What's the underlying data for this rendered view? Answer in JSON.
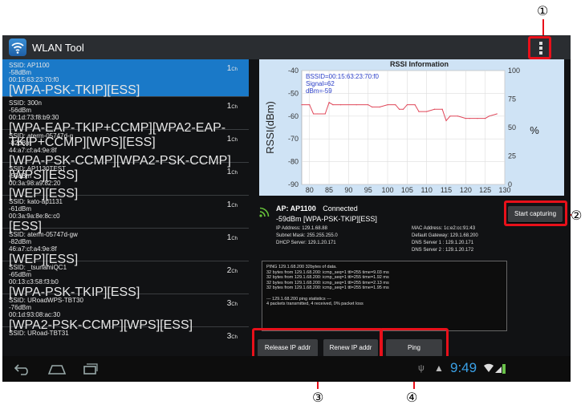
{
  "app": {
    "title": "WLAN Tool"
  },
  "networks": [
    {
      "ssid": "SSID: AP1100",
      "signal": "-58dBm",
      "bssid": "00:15:63:23:70:f0",
      "security": "[WPA-PSK-TKIP][ESS]",
      "channel": "1",
      "ch_unit": "Ch"
    },
    {
      "ssid": "SSID: 300n",
      "signal": "-56dBm",
      "bssid": "00:1d:73:f8:b9:30",
      "security": "[WPA-EAP-TKIP+CCMP][WPA2-EAP-TKIP+CCMP][WPS][ESS]",
      "channel": "1",
      "ch_unit": "Ch"
    },
    {
      "ssid": "SSID: aterm-05747d-g",
      "signal": "-82dBm",
      "bssid": "44:a7:cf:a4:9e:8f",
      "security": "[WPA-PSK-CCMP][WPA2-PSK-CCMP][WPS][ESS]",
      "channel": "1",
      "ch_unit": "Ch"
    },
    {
      "ssid": "SSID: AP1130TEST",
      "signal": "-53dBm",
      "bssid": "00:3a:98:a9:82:20",
      "security": "[WEP][ESS]",
      "channel": "1",
      "ch_unit": "Ch"
    },
    {
      "ssid": "SSID: kato-ap1131",
      "signal": "-61dBm",
      "bssid": "00:3a:9a:8e:8c:c0",
      "security": "[ESS]",
      "channel": "1",
      "ch_unit": "Ch"
    },
    {
      "ssid": "SSID: aterm-05747d-gw",
      "signal": "-82dBm",
      "bssid": "46:a7:cf:a4:9e:8f",
      "security": "[WEP][ESS]",
      "channel": "1",
      "ch_unit": "Ch"
    },
    {
      "ssid": "SSID: _tsunamiQC1",
      "signal": "-65dBm",
      "bssid": "00:13:c3:58:f3:b0",
      "security": "[WPA-PSK-TKIP][ESS]",
      "channel": "2",
      "ch_unit": "Ch"
    },
    {
      "ssid": "SSID: URoadWPS-TBT30",
      "signal": "-76dBm",
      "bssid": "00:1d:93:08:ac:30",
      "security": "[WPA2-PSK-CCMP][WPS][ESS]",
      "channel": "3",
      "ch_unit": "Ch"
    },
    {
      "ssid": "SSID: URoad-TBT31",
      "signal": "",
      "bssid": "",
      "security": "",
      "channel": "3",
      "ch_unit": "Ch"
    }
  ],
  "rssi": {
    "title": "RSSI Information",
    "bssid": "BSSID=00:15:63:23:70:f0",
    "signal": "Signal=62",
    "dbm": "dBm=-59",
    "y_label": "RSSI(dBm)",
    "y2_label": "%"
  },
  "chart_data": {
    "type": "line",
    "title": "RSSI Information",
    "ylabel": "RSSI(dBm)",
    "y2label": "%",
    "xlim": [
      78,
      130
    ],
    "ylim": [
      -90,
      -40
    ],
    "y2lim": [
      0,
      100
    ],
    "x_ticks": [
      80,
      85,
      90,
      95,
      100,
      105,
      110,
      115,
      120,
      125,
      130
    ],
    "y_ticks": [
      -90,
      -80,
      -70,
      -60,
      -50,
      -40
    ],
    "y2_ticks": [
      0,
      25,
      50,
      75,
      100
    ],
    "grid": true,
    "series": [
      {
        "color": "#e0485a",
        "x": [
          78,
          80,
          81,
          82,
          84,
          85,
          86,
          88,
          92,
          95,
          96,
          98,
          100,
          102,
          103,
          104,
          105,
          107,
          108,
          110,
          112,
          114,
          115,
          116,
          118,
          120,
          121,
          123,
          125,
          126,
          128
        ],
        "y": [
          -55,
          -55,
          -59,
          -59,
          -59,
          -54,
          -55,
          -55,
          -55,
          -55,
          -56,
          -56,
          -55,
          -55,
          -57,
          -57,
          -55,
          -55,
          -58,
          -58,
          -57,
          -57,
          -62,
          -60,
          -60,
          -61,
          -61,
          -61,
          -61,
          -60,
          -59
        ]
      }
    ]
  },
  "connection": {
    "ap": "AP: AP1100",
    "status": "Connected",
    "signal_security": "-59dBm  [WPA-PSK-TKIP][ESS]",
    "ip": "IP Address: 129.1.68.88",
    "subnet": "Subnet Mask: 255.255.255.0",
    "dhcp": "DHCP Server: 129.1.20.171",
    "mac": "MAC Address: 1c:e2:cc:91:43",
    "gateway": "Default Gateway: 129.1.68.200",
    "dns1": "DNS Server 1 : 129.1.20.171",
    "dns2": "DNS Server 2 : 129.1.20.172"
  },
  "ping_output": [
    "PING 129.1.68.200 32bytes of data.",
    "32 bytes from 129.1.68.200: icmp_seq=1 ttl=255 time=9.03 ms",
    "32 bytes from 129.1.68.200: icmp_seq=1 ttl=255 time=1.92 ms",
    "32 bytes from 129.1.68.200: icmp_seq=1 ttl=255 time=2.13 ms",
    "32 bytes from 129.1.68.200: icmp_seq=1 ttl=255 time=1.95 ms",
    "",
    "--- 129.1.68.200 ping statistics ---",
    "4 packets transmitted, 4 received, 0% packet loss"
  ],
  "buttons": {
    "start_capturing": "Start capturing",
    "release_ip": "Release IP addr",
    "renew_ip": "Renew IP addr",
    "ping": "Ping"
  },
  "status_bar": {
    "time": "9:49"
  },
  "callouts": {
    "c1": "①",
    "c2": "②",
    "c3": "③",
    "c4": "④"
  },
  "colors": {
    "accent": "#1a79c8",
    "callout": "#e8101a",
    "line": "#e0485a",
    "chart_bg": "#cfe3f5"
  }
}
